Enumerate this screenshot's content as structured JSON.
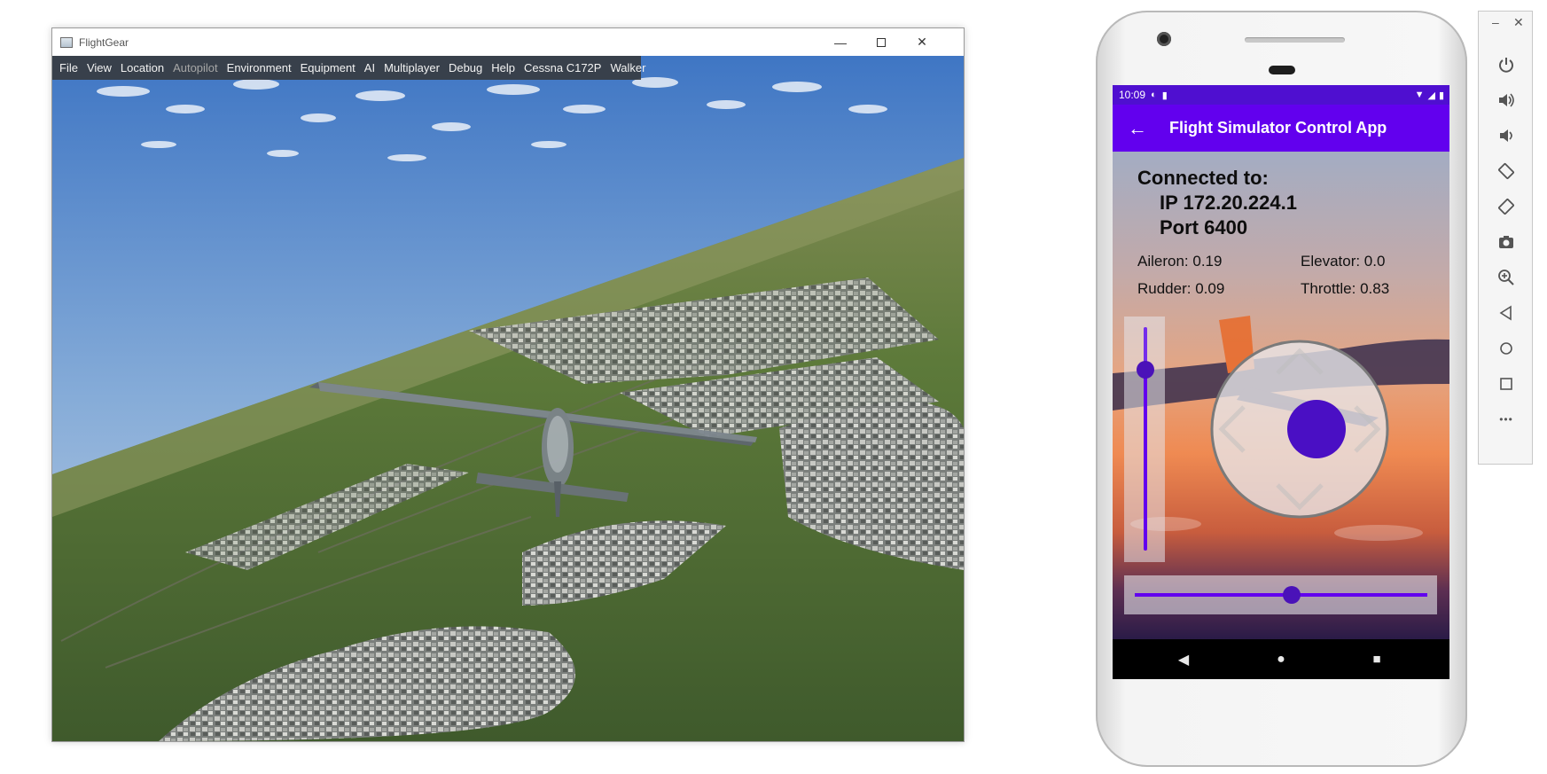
{
  "flightgear": {
    "window_title": "FlightGear",
    "window_controls": {
      "minimize": "—",
      "close": "✕"
    },
    "menu": [
      "File",
      "View",
      "Location",
      "Autopilot",
      "Environment",
      "Equipment",
      "AI",
      "Multiplayer",
      "Debug",
      "Help",
      "Cessna C172P",
      "Walker"
    ],
    "disabled_menu": "Autopilot"
  },
  "phone": {
    "status": {
      "time": "10:09",
      "left_icons": [
        "sync-icon",
        "sd-card-icon"
      ],
      "right_icons": [
        "wifi-icon",
        "signal-icon",
        "battery-icon"
      ]
    },
    "app_bar": {
      "back": "←",
      "title": "Flight Simulator Control App"
    },
    "connection": {
      "label": "Connected to:",
      "ip": "IP 172.20.224.1",
      "port": "Port 6400"
    },
    "values": {
      "aileron": "Aileron: 0.19",
      "elevator": "Elevator: 0.0",
      "rudder": "Rudder: 0.09",
      "throttle": "Throttle: 0.83"
    },
    "controls": {
      "throttle_slider": 0.83,
      "rudder_slider": 0.54,
      "joystick_aileron": 0.19,
      "joystick_elevator": 0.0
    },
    "nav": {
      "back": "◀",
      "home": "●",
      "recents": "■"
    },
    "accent": "#6200ee",
    "status_bar_color": "#4f0fd0"
  },
  "emulator_toolbar": {
    "window_controls": {
      "minimize": "–",
      "close": "✕"
    },
    "buttons": [
      "power-icon",
      "volume-up-icon",
      "volume-down-icon",
      "rotate-left-icon",
      "rotate-right-icon",
      "camera-icon",
      "zoom-icon",
      "back-icon",
      "home-icon",
      "overview-icon",
      "more-icon"
    ],
    "more_label": "•••"
  }
}
